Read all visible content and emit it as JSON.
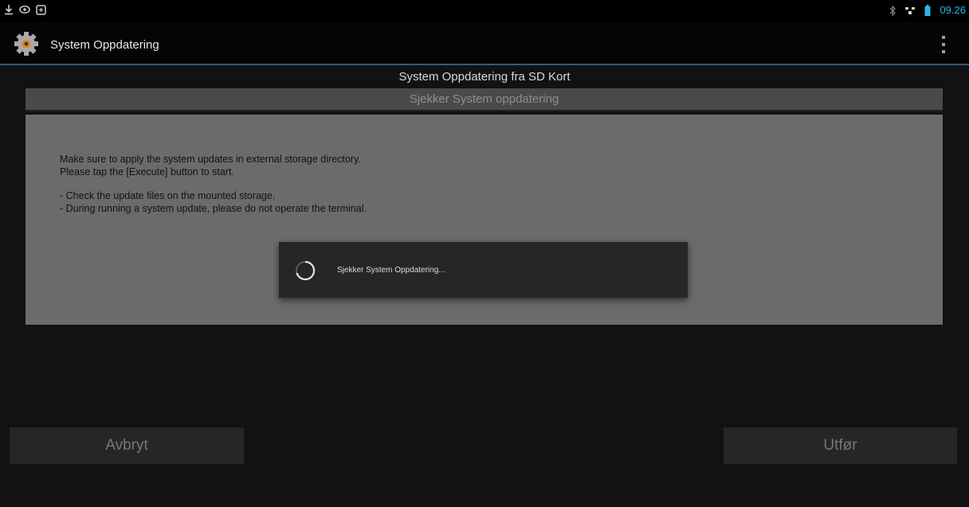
{
  "status_bar": {
    "left_icons": [
      "download-icon",
      "eye-icon",
      "screen-icon"
    ],
    "right_icons": [
      "bluetooth-off-icon",
      "network-icon",
      "battery-icon"
    ],
    "time": "09.26"
  },
  "action_bar": {
    "app_icon": "gear-icon",
    "title": "System Oppdatering",
    "overflow_icon": "overflow-menu-icon"
  },
  "main": {
    "title": "System Oppdatering fra SD Kort",
    "subtitle": "Sjekker System oppdatering",
    "info_lines": [
      "Make sure to apply the system updates in external storage directory.",
      "Please tap the [Execute] button to start.",
      "- Check the update files on the mounted storage.",
      "- During running a system update, please do not operate the terminal."
    ]
  },
  "dialog": {
    "icon": "spinner-icon",
    "message": "Sjekker System Oppdatering..."
  },
  "buttons": {
    "cancel": "Avbryt",
    "execute": "Utfør"
  },
  "colors": {
    "accent": "#33b5e5",
    "divider": "#2c5f7a",
    "panel": "#6b6b6b"
  }
}
